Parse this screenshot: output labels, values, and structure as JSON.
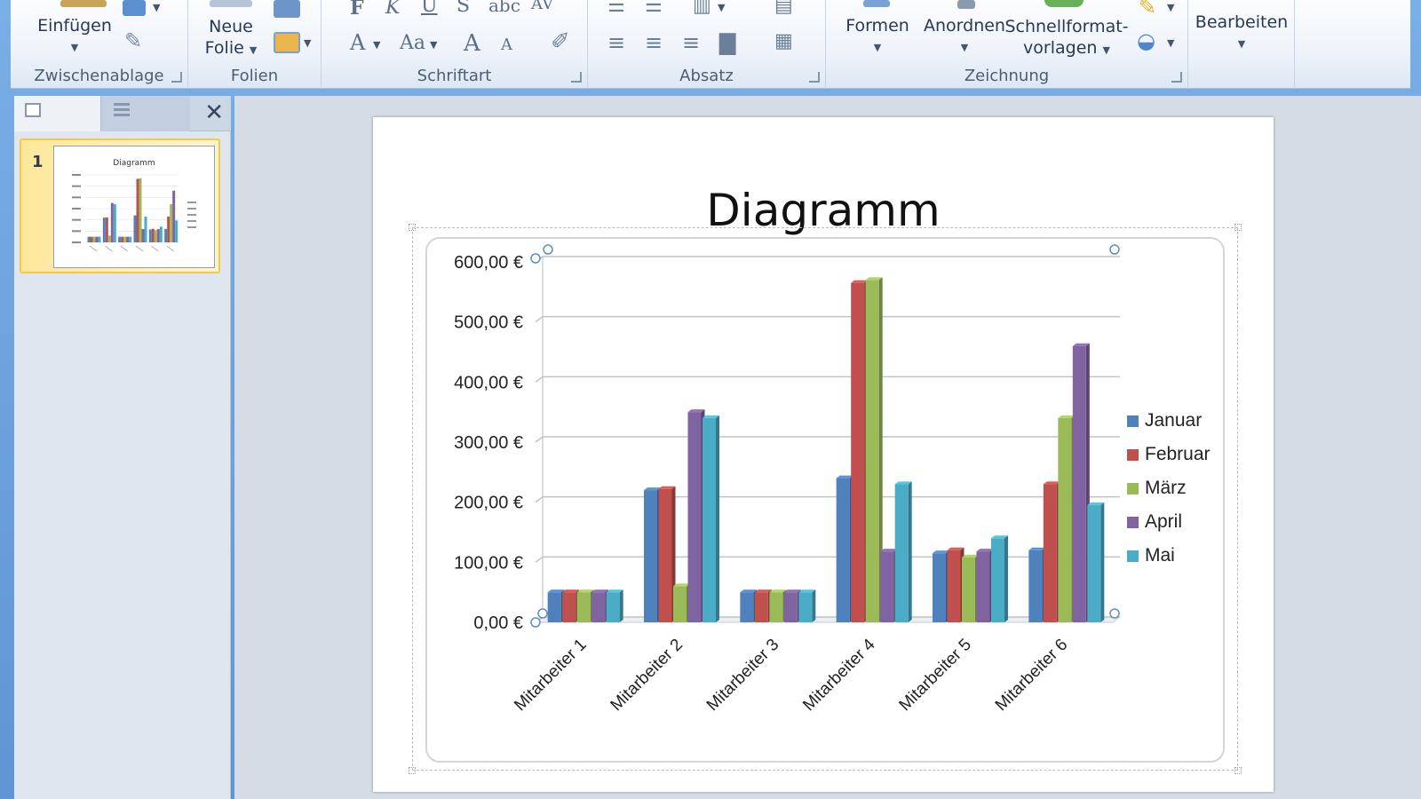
{
  "ribbon": {
    "clipboard": {
      "paste_label": "Einfügen",
      "group_label": "Zwischenablage"
    },
    "slides": {
      "new_slide_line1": "Neue",
      "new_slide_line2": "Folie",
      "group_label": "Folien"
    },
    "font": {
      "group_label": "Schriftart",
      "bold": "F",
      "italic": "K",
      "underline": "U",
      "strike": "S",
      "shadow": "abc",
      "spacing": "AV",
      "font_color": "A",
      "case": "Aa",
      "grow": "A",
      "shrink": "A"
    },
    "paragraph": {
      "group_label": "Absatz"
    },
    "drawing": {
      "shapes_label": "Formen",
      "arrange_label": "Anordnen",
      "quick_styles_line1": "Schnellformat-",
      "quick_styles_line2": "vorlagen",
      "group_label": "Zeichnung"
    },
    "editing": {
      "edit_label": "Bearbeiten"
    }
  },
  "left_pane": {
    "close_glyph": "✕",
    "thumbnails": [
      {
        "number": "1",
        "title": "Diagramm"
      }
    ]
  },
  "slide": {
    "title": "Diagramm"
  },
  "colors": {
    "Januar": "#4f81bd",
    "Februar": "#c0504d",
    "März": "#9bbb59",
    "April": "#8064a2",
    "Mai": "#4bacc6"
  },
  "chart_data": {
    "type": "bar",
    "title": "Diagramm",
    "categories": [
      "Mitarbeiter 1",
      "Mitarbeiter 2",
      "Mitarbeiter 3",
      "Mitarbeiter 4",
      "Mitarbeiter 5",
      "Mitarbeiter 6"
    ],
    "series": [
      {
        "name": "Januar",
        "values": [
          50,
          220,
          50,
          240,
          115,
          120
        ]
      },
      {
        "name": "Februar",
        "values": [
          50,
          222,
          50,
          565,
          120,
          230
        ]
      },
      {
        "name": "März",
        "values": [
          50,
          60,
          50,
          570,
          108,
          340
        ]
      },
      {
        "name": "April",
        "values": [
          50,
          350,
          50,
          118,
          118,
          460
        ]
      },
      {
        "name": "Mai",
        "values": [
          50,
          340,
          50,
          230,
          140,
          195
        ]
      }
    ],
    "yticks": [
      "0,00 €",
      "100,00 €",
      "200,00 €",
      "300,00 €",
      "400,00 €",
      "500,00 €",
      "600,00 €"
    ],
    "ylim": [
      0,
      600
    ],
    "grid": true,
    "legend": "right"
  }
}
